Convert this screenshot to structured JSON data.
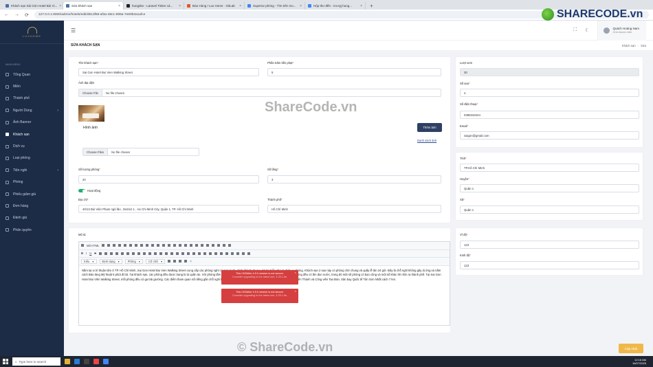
{
  "browser": {
    "tabs": [
      {
        "label": "Khách sạn Sài Gòn Hotel Bùi Vi...",
        "color": "#4a6fa5"
      },
      {
        "label": "Sửa khách sạn",
        "color": "#4a6fa5",
        "active": true
      },
      {
        "label": "hungdev - Laravel Tinker cá...",
        "color": "#222"
      },
      {
        "label": "Đào Hùng / Lux Home · GitLab",
        "color": "#e2572b"
      },
      {
        "label": "Superior phòng - Tìm trên Go...",
        "color": "#4285f4"
      },
      {
        "label": "Hộp thư đến - mr.eyj.hung...",
        "color": "#4285f4"
      }
    ],
    "url": "127.0.0.1:8000/admin/hotels/edit/d613f69-af3a-48c1-889a-7e80b3a1afce"
  },
  "brand": {
    "logo_text": "LUXHOME",
    "watermark": "ShareCode.vn",
    "corner_logo": "SHARECODE.vn"
  },
  "sidebar": {
    "section_title": "MAIN MENU",
    "items": [
      {
        "label": "Tổng Quan"
      },
      {
        "label": "Miền"
      },
      {
        "label": "Thành phố"
      },
      {
        "label": "Người Dùng",
        "chev": true
      },
      {
        "label": "Ảnh Banner"
      },
      {
        "label": "Khách sạn",
        "active": true
      },
      {
        "label": "Dịch vụ"
      },
      {
        "label": "Loại phòng"
      },
      {
        "label": "Tiện nghi",
        "chev": true
      },
      {
        "label": "Phòng"
      },
      {
        "label": "Phiếu giảm giá"
      },
      {
        "label": "Đơn hàng"
      },
      {
        "label": "Đánh giá"
      },
      {
        "label": "Phân quyền"
      }
    ]
  },
  "header": {
    "user_name": "Quách Hoàng Nam",
    "user_role": "Chủ khuôn viên"
  },
  "page": {
    "title": "SỬA KHÁCH SẠN",
    "crumb_1": "Khách sạn",
    "crumb_sep": "›",
    "crumb_2": "Sửa"
  },
  "form": {
    "name_label": "Tên khách sạn",
    "name_value": "Sai Gon Hotel Bui Vien Walking Street",
    "fee_label": "Phần trăm tiền phạt",
    "fee_value": "5",
    "image_label": "Ảnh đại diện",
    "choose_file": "Choose File",
    "no_file": "No file chosen",
    "gallery_title": "Hình ảnh",
    "add_image_button": "Thêm ảnh",
    "gallery_link": "Danh sách ảnh",
    "choose_files": "Choose Files",
    "no_file_2": "No file chosen",
    "rooms_label": "Số lượng phòng",
    "rooms_value": "20",
    "floors_label": "Số tầng",
    "floors_value": "3",
    "active_label": "Hoạt động",
    "address_label": "Địa chỉ",
    "address_value": "40/13 Bùi Viện Phạm ngũ lão , District 1 , Ho Chi Minh City, Quận 1, TP. Hồ Chí Minh",
    "city_label": "Thành phố",
    "city_value": "Hồ Chí Minh",
    "desc_label": "Mô tả",
    "desc_text": "Nằm tại vị trí thuận tiện ở TP. Hồ Chí Minh, Sai Gon Hotel Bui Vien Walking Street cung cấp các phòng nghỉ có máy lạnh, sảnh khách chung, Wi-Fi miễn phí và dịch vụ phòng. Khách sạn 2 sao này có phòng chờ chung và quầy lễ tân 24 giờ. Đây là chỗ nghỉ không gây dị ứng và nằm cách Bảo tàng Mỹ thuật 6 phút đi bộ. Tại khách sạn, các phòng đều được trang bị tủ quần áo. Với phòng tắm riêng, phòng tắm đứng, ga trải giường và khăn tắm. Các phòng đều có ấm đun nước, trong đó một số phòng có ban công và một số khác thì nhìn ra thành phố. Tại Sai Gon Hotel Bui Viên Walking Street, mỗi phòng đều có ga trải giường. Các điểm tham quan nổi tiếng gần chỗ nghỉ bao gồm Trung tâm mua sắm Takashimaya Việt Nam, Chợ Bến Thành và Công viên Tao Đàn. Sân bay Quốc tế Tân Sơn Nhất cách 7 km.",
    "editor_source": "Mã HTML",
    "editor_format": "Kiểu",
    "editor_style": "Định dạng",
    "editor_font": "Phông",
    "editor_size": "Cỡ chữ",
    "warning_line_1": "This CKEditor 4.9.0 version is not secure.",
    "warning_line_2": "Consider upgrading to the latest one, 4.25.1-lts.",
    "save_button": "Cập nhật"
  },
  "right": {
    "views_label": "Lượt xem",
    "views_value": "30",
    "stars_label": "Số sao",
    "stars_value": "4",
    "phone_label": "Số điện thoại",
    "phone_value": "0385333444",
    "email_label": "Email",
    "email_value": "saigon@gmail.com",
    "province_label": "Tỉnh",
    "province_value": "TP.Hồ Chí Minh",
    "district_label": "Huyện",
    "district_value": "Quận 1",
    "ward_label": "Xã",
    "ward_value": "Quận 1",
    "lat_label": "Vĩ độ",
    "lat_value": "123",
    "lng_label": "Kinh độ",
    "lng_value": "123"
  },
  "taskbar": {
    "search_placeholder": "Type here to search",
    "time": "12:16 AM",
    "date": "16/07/2025"
  }
}
